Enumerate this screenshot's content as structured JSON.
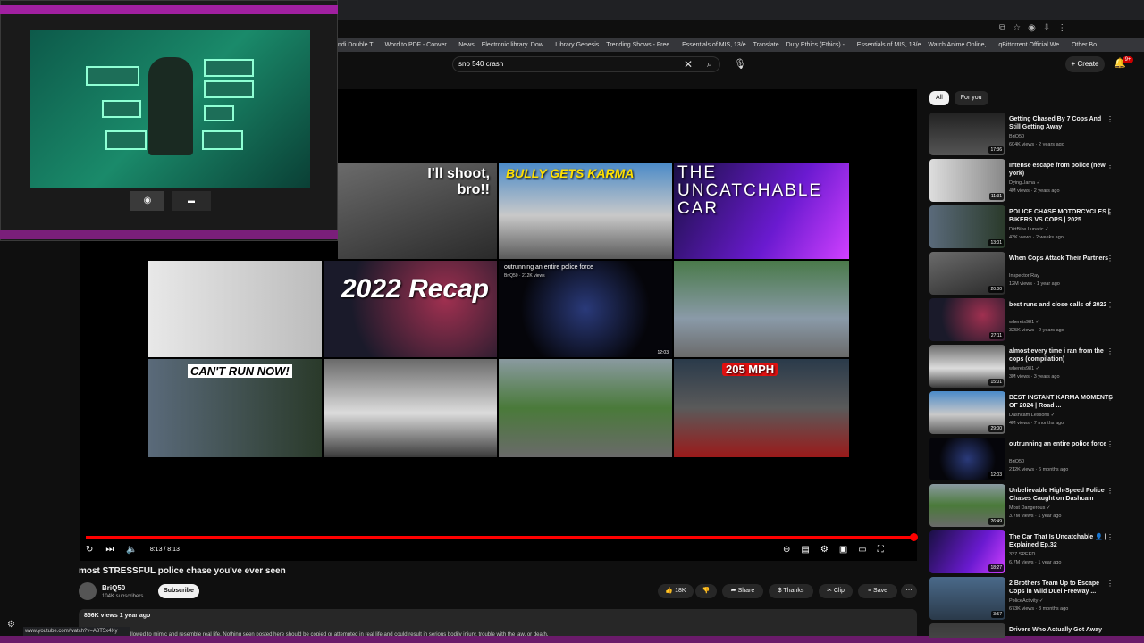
{
  "search": {
    "query": "sno 540 crash"
  },
  "header": {
    "create_label": "Create",
    "notifications_badge": "9+"
  },
  "bookmarks": [
    "ndi Double T...",
    "Word to PDF - Conver...",
    "News",
    "Electronic library. Dow...",
    "Library Genesis",
    "Trending Shows - Free...",
    "Essentials of MIS, 13/e",
    "Translate",
    "Duty Ethics (Ethics) -...",
    "Essentials of MIS, 13/e",
    "Watch Anime Online,...",
    "qBittorrent Official We...",
    "Other Bo"
  ],
  "player": {
    "time": "8:13 / 8:13",
    "tiles": {
      "t1": "I'll shoot, bro!!",
      "t2": "BULLY GETS KARMA",
      "t3": "THE UNCATCHABLE CAR",
      "t5": "2022 Recap",
      "t6_title": "outrunning an entire police force",
      "t6_meta": "BriQ50 · 212K views",
      "t6_dur": "12:03",
      "t9": "CAN'T RUN NOW!",
      "t12": "205 MPH"
    }
  },
  "video": {
    "title": "most STRESSFUL police chase you've ever seen",
    "channel": "BriQ50",
    "subscribers": "104K subscribers",
    "subscribe_label": "Subscribe",
    "likes": "18K",
    "share_label": "Share",
    "thanks_label": "Thanks",
    "clip_label": "Clip",
    "save_label": "Save",
    "meta": "856K views  1 year ago",
    "description": "...posted here are allowed to mimic and resemble real life. Nothing seen posted here should be copied or attempted in real life and could result in serious bodily injury, trouble with the law, or death."
  },
  "status_url": "www.youtube.com/watch?v=A8T5x4Xy",
  "chips": [
    "All",
    "For you"
  ],
  "recommendations": [
    {
      "title": "Getting Chased By 7 Cops And Still Getting Away",
      "channel": "BriQ50",
      "stats": "604K views · 2 years ago",
      "duration": "17:36"
    },
    {
      "title": "Intense escape from police (new york)",
      "channel": "DyingLlama ✓",
      "stats": "4M views · 2 years ago",
      "duration": "11:31"
    },
    {
      "title": "POLICE CHASE MOTORCYCLES | BIKERS VS COPS | 2025",
      "channel": "DirtBike Lunatic ✓",
      "stats": "43K views · 2 weeks ago",
      "duration": "13:01"
    },
    {
      "title": "When Cops Attack Their Partners",
      "channel": "Inspector Ray",
      "stats": "12M views · 1 year ago",
      "duration": "20:00"
    },
    {
      "title": "best runs and close calls of 2022",
      "channel": "whereis981 ✓",
      "stats": "325K views · 2 years ago",
      "duration": "27:11"
    },
    {
      "title": "almost every time i ran from the cops (compilation)",
      "channel": "whereis981 ✓",
      "stats": "3M views · 3 years ago",
      "duration": "15:01"
    },
    {
      "title": "BEST INSTANT KARMA MOMENTS OF 2024 | Road ...",
      "channel": "Dashcam Lessons ✓",
      "stats": "4M views · 7 months ago",
      "duration": "29:00"
    },
    {
      "title": "outrunning an entire police force",
      "channel": "BriQ50",
      "stats": "212K views · 6 months ago",
      "duration": "12:03"
    },
    {
      "title": "Unbelievable High-Speed Police Chases Caught on Dashcam",
      "channel": "Most Dangerous ✓",
      "stats": "3.7M views · 1 year ago",
      "duration": "26:49"
    },
    {
      "title": "The Car That Is Uncatchable 👤 | Explained Ep.32",
      "channel": "337.SPEED",
      "stats": "6.7M views · 1 year ago",
      "duration": "18:27"
    },
    {
      "title": "2 Brothers Team Up to Escape Cops in Wild Duel Freeway ...",
      "channel": "PoliceActivity ✓",
      "stats": "673K views · 3 months ago",
      "duration": "3:57"
    },
    {
      "title": "Drivers Who Actually Got Away",
      "channel": "",
      "stats": "",
      "duration": ""
    }
  ],
  "colors": {
    "accent": "#ff0000",
    "bg": "#0f0f0f",
    "chip_active": "#f1f1f1"
  }
}
